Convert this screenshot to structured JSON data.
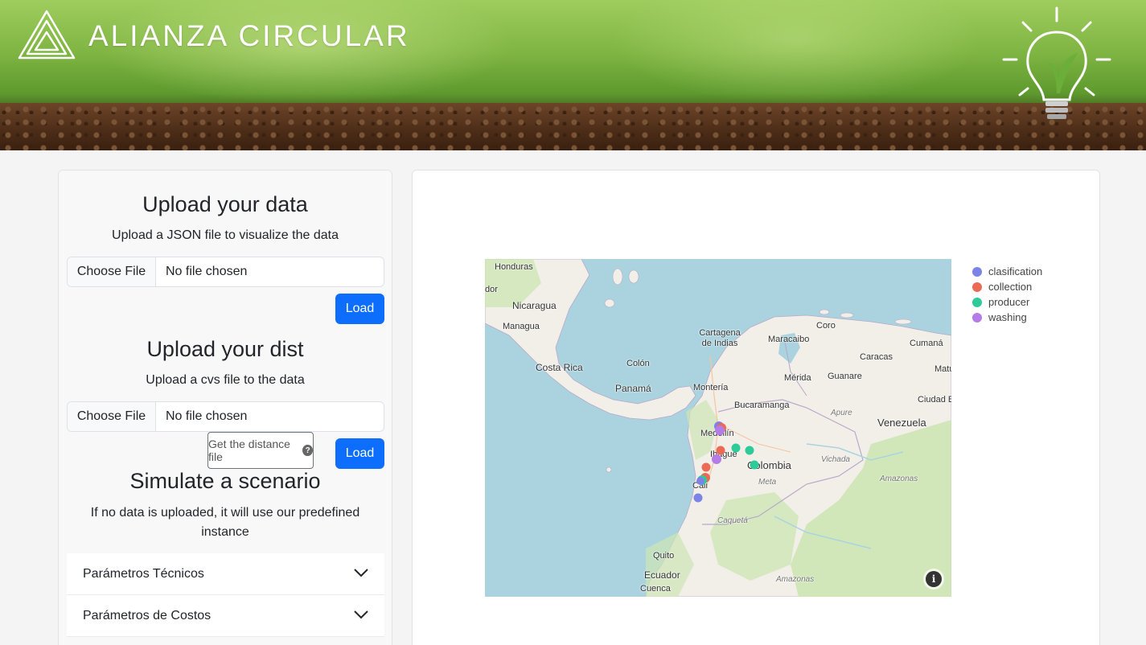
{
  "header": {
    "brand": "ALIANZA CIRCULAR"
  },
  "upload_data": {
    "title": "Upload your data",
    "subtitle": "Upload a JSON file to visualize the data",
    "choose_label": "Choose File",
    "file_status": "No file chosen",
    "load_label": "Load"
  },
  "upload_dist": {
    "title": "Upload your dist",
    "subtitle": "Upload a cvs file to the data",
    "choose_label": "Choose File",
    "file_status": "No file chosen",
    "distance_button": "Get the distance file",
    "help_glyph": "?",
    "load_label": "Load"
  },
  "simulate": {
    "title": "Simulate a scenario",
    "subtitle": "If no data is uploaded, it will use our predefined instance",
    "accordion": [
      {
        "label": "Parámetros Técnicos"
      },
      {
        "label": "Parámetros de Costos"
      }
    ]
  },
  "map": {
    "labels": {
      "honduras": "Honduras",
      "edge_dor": "dor",
      "nicaragua": "Nicaragua",
      "managua": "Managua",
      "costa_rica": "Costa Rica",
      "colon": "Colón",
      "panama": "Panamá",
      "cartagena": "Cartagena de Indias",
      "maracaibo": "Maracaibo",
      "coro": "Coro",
      "caracas": "Caracas",
      "cumana": "Cumaná",
      "matu": "Matu",
      "merida": "Mérida",
      "guanare": "Guanare",
      "ciudad_bo": "Ciudad Bo",
      "monteria": "Montería",
      "bucaramanga": "Bucaramanga",
      "apure": "Apure",
      "venezuela": "Venezuela",
      "medellin": "Medellín",
      "ibague": "Ibagué",
      "colombia": "Colombia",
      "vichada": "Vichada",
      "meta": "Meta",
      "amazonas1": "Amazonas",
      "cali": "Cali",
      "caqueta": "Caquetá",
      "quito": "Quito",
      "ecuador": "Ecuador",
      "cuenca": "Cuenca",
      "amazonas2": "Amazonas"
    },
    "info_glyph": "i"
  },
  "legend": [
    {
      "name": "clasification",
      "color": "#7b83e6"
    },
    {
      "name": "collection",
      "color": "#ea6a55"
    },
    {
      "name": "producer",
      "color": "#2dcb98"
    },
    {
      "name": "washing",
      "color": "#b57be6"
    }
  ]
}
